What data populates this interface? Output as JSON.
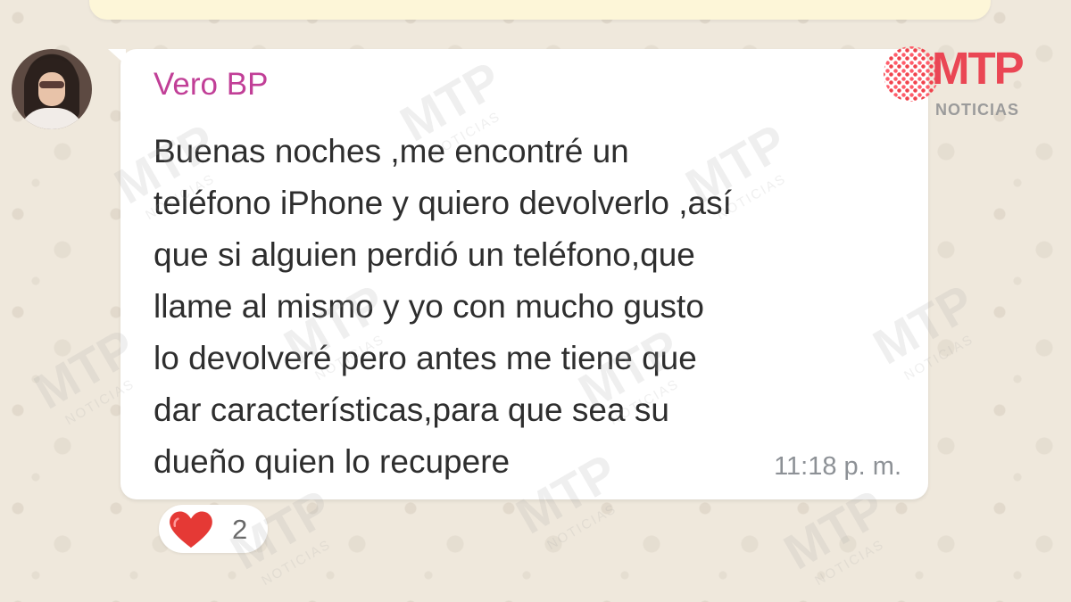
{
  "chat": {
    "sender_name": "Vero BP",
    "message": "Buenas noches ,me encontré un\nteléfono iPhone y quiero devolverlo ,así\nque si alguien perdió un teléfono,que\nllame al mismo y yo con mucho gusto\nlo devolveré pero antes me tiene que\ndar características,para que sea su\ndueño quien lo recupere",
    "time": "11:18 p. m.",
    "reaction": {
      "icon": "heart-icon",
      "count": "2"
    },
    "colors": {
      "name": "#c13f97",
      "bubble": "#ffffff",
      "heart": "#e53935",
      "background": "#efe8dc"
    }
  },
  "branding": {
    "logo_mark": "MTP",
    "logo_sub": "NOTICIAS"
  },
  "watermark": {
    "mark": "MTP",
    "sub": "NOTICIAS"
  }
}
